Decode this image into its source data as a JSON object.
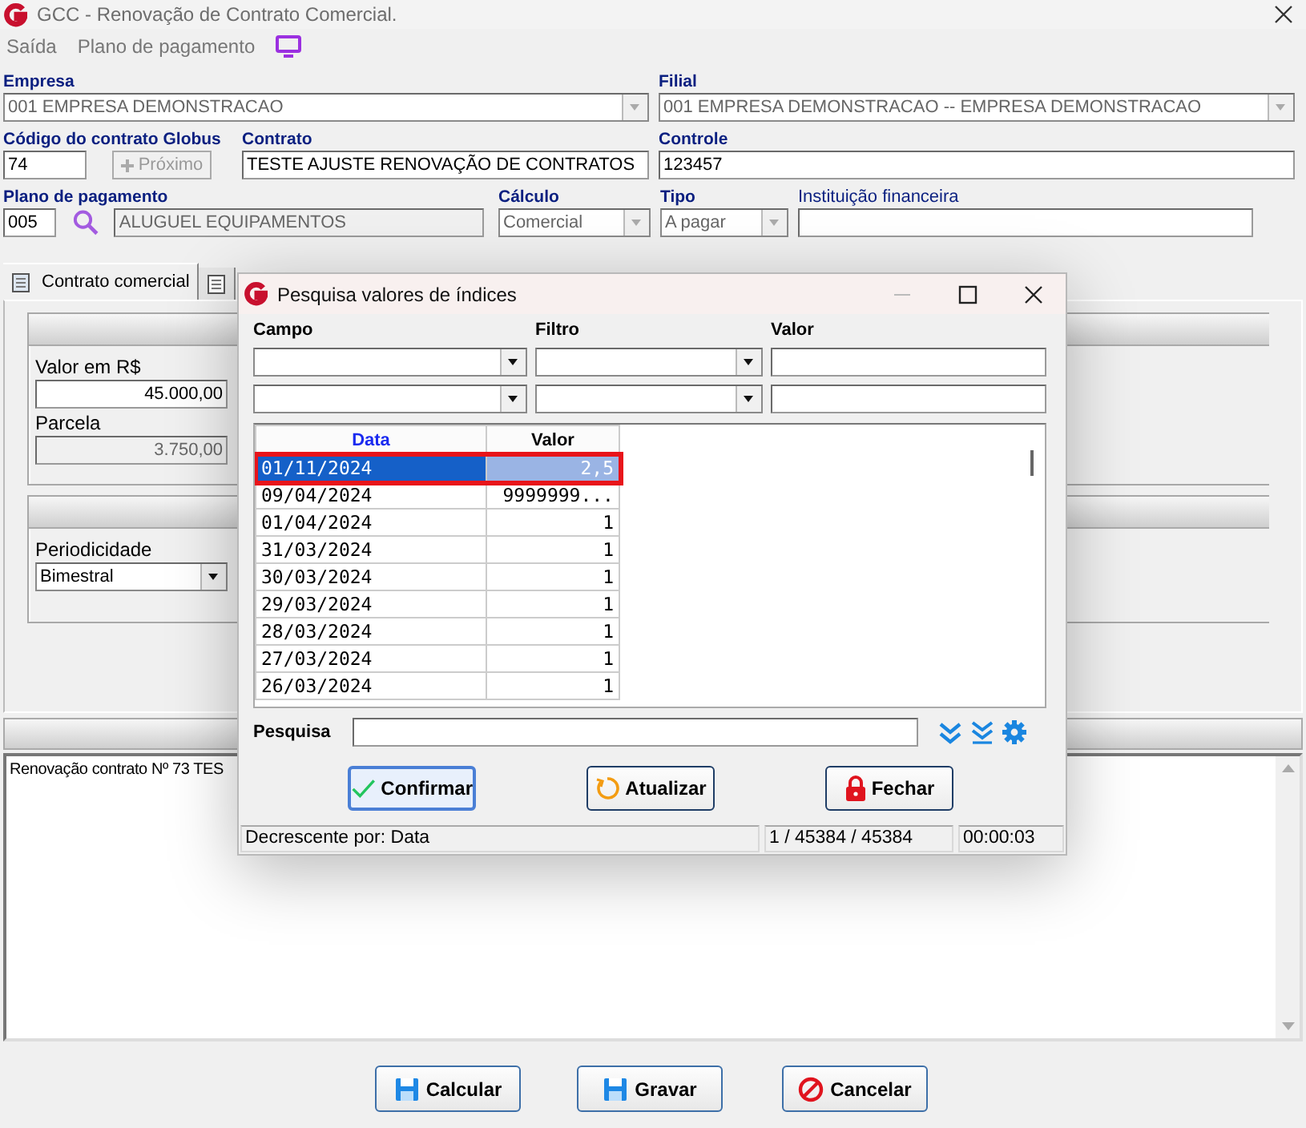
{
  "window": {
    "title": "GCC - Renovação de Contrato Comercial."
  },
  "menu": [
    {
      "label": "Saída"
    },
    {
      "label": "Plano de pagamento"
    }
  ],
  "form": {
    "empresa": {
      "label": "Empresa",
      "value": "001 EMPRESA DEMONSTRACAO"
    },
    "filial": {
      "label": "Filial",
      "value": "001 EMPRESA DEMONSTRACAO -- EMPRESA DEMONSTRACAO"
    },
    "codigo": {
      "label": "Código do contrato Globus",
      "value": "74"
    },
    "proximo": {
      "label": "Próximo",
      "disabled": true
    },
    "contrato": {
      "label": "Contrato",
      "value": "TESTE AJUSTE RENOVAÇÃO DE CONTRATOS"
    },
    "controle": {
      "label": "Controle",
      "value": "123457"
    },
    "plano": {
      "label": "Plano de pagamento",
      "code": "005",
      "description": "ALUGUEL EQUIPAMENTOS"
    },
    "calculo": {
      "label": "Cálculo",
      "value": "Comercial",
      "disabled": true
    },
    "tipo": {
      "label": "Tipo",
      "value": "A pagar",
      "disabled": true
    },
    "instituicao": {
      "label": "Instituição financeira"
    }
  },
  "tabs": [
    {
      "label": "Contrato comercial",
      "selected": true
    },
    {
      "selected": false
    }
  ],
  "panel": {
    "valor": {
      "label": "Valor em R$",
      "value": "45.000,00"
    },
    "parcela": {
      "label": "Parcela",
      "value": "3.750,00",
      "disabled": true
    },
    "periodicidade": {
      "label": "Periodicidade",
      "value": "Bimestral"
    }
  },
  "memo": {
    "text": "Renovação contrato Nº 73 TES"
  },
  "buttons": [
    {
      "label": "Calcular",
      "kind": "save"
    },
    {
      "label": "Gravar",
      "kind": "save"
    },
    {
      "label": "Cancelar",
      "kind": "cancel"
    }
  ],
  "dialog": {
    "title": "Pesquisa valores de índices",
    "filter_labels": [
      "Campo",
      "Filtro",
      "Valor"
    ],
    "grid": {
      "columns": [
        {
          "label": "Data",
          "sorted": true
        },
        {
          "label": "Valor",
          "sorted": false
        }
      ],
      "rows": [
        {
          "data": "01/11/2024",
          "valor": "2,5",
          "selected": true,
          "highlighted": true
        },
        {
          "data": "09/04/2024",
          "valor": "9999999...",
          "selected": false,
          "highlighted": false
        },
        {
          "data": "01/04/2024",
          "valor": "1",
          "selected": false,
          "highlighted": false
        },
        {
          "data": "31/03/2024",
          "valor": "1",
          "selected": false,
          "highlighted": false
        },
        {
          "data": "30/03/2024",
          "valor": "1",
          "selected": false,
          "highlighted": false
        },
        {
          "data": "29/03/2024",
          "valor": "1",
          "selected": false,
          "highlighted": false
        },
        {
          "data": "28/03/2024",
          "valor": "1",
          "selected": false,
          "highlighted": false
        },
        {
          "data": "27/03/2024",
          "valor": "1",
          "selected": false,
          "highlighted": false
        },
        {
          "data": "26/03/2024",
          "valor": "1",
          "selected": false,
          "highlighted": false
        }
      ]
    },
    "search_label": "Pesquisa",
    "buttons": [
      {
        "label": "Confirmar",
        "kind": "confirm",
        "default": true
      },
      {
        "label": "Atualizar",
        "kind": "refresh",
        "default": false
      },
      {
        "label": "Fechar",
        "kind": "close",
        "default": false
      }
    ],
    "status": [
      "Decrescente por: Data",
      "1 / 45384 / 45384",
      "00:00:03"
    ]
  }
}
